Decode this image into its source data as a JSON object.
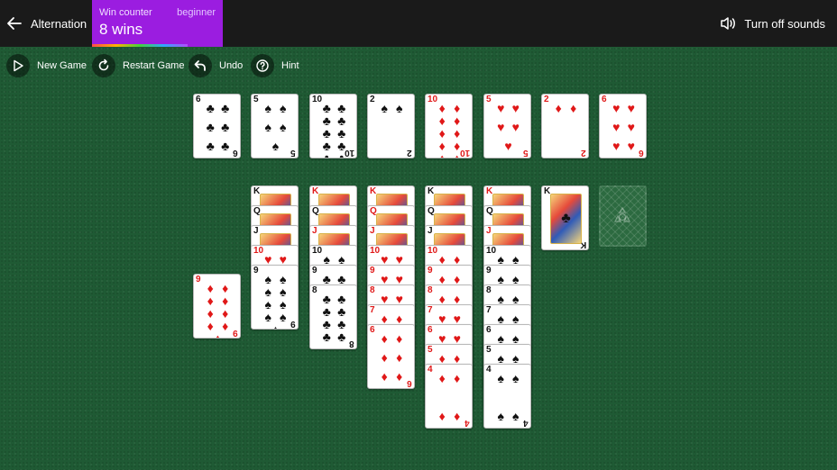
{
  "header": {
    "back_label": "Alternation",
    "win_counter_label": "Win counter",
    "level": "beginner",
    "wins": "8 wins",
    "sound_label": "Turn off sounds"
  },
  "toolbar": {
    "new_game": "New Game",
    "restart_game": "Restart Game",
    "undo": "Undo",
    "hint": "Hint"
  },
  "colors": {
    "felt": "#1f5a34",
    "topbar": "#1a1a1a",
    "win_card": "#9b1de0",
    "red_suit": "#e01818"
  },
  "foundations": [
    {
      "rank": "6",
      "suit": "♣",
      "color": "black"
    },
    {
      "rank": "5",
      "suit": "♠",
      "color": "black"
    },
    {
      "rank": "10",
      "suit": "♣",
      "color": "black"
    },
    {
      "rank": "2",
      "suit": "♠",
      "color": "black"
    },
    {
      "rank": "10",
      "suit": "♦",
      "color": "red"
    },
    {
      "rank": "5",
      "suit": "♥",
      "color": "red"
    },
    {
      "rank": "2",
      "suit": "♦",
      "color": "red"
    },
    {
      "rank": "6",
      "suit": "♥",
      "color": "red"
    }
  ],
  "tableau": [
    {
      "cards": [
        {
          "rank": "9",
          "suit": "♦",
          "color": "red"
        }
      ]
    },
    {
      "cards": [
        {
          "rank": "K",
          "suit": "♠",
          "color": "black"
        },
        {
          "rank": "Q",
          "suit": "♣",
          "color": "black"
        },
        {
          "rank": "J",
          "suit": "♣",
          "color": "black"
        },
        {
          "rank": "10",
          "suit": "♥",
          "color": "red"
        },
        {
          "rank": "9",
          "suit": "♠",
          "color": "black"
        }
      ]
    },
    {
      "cards": [
        {
          "rank": "K",
          "suit": "♦",
          "color": "red"
        },
        {
          "rank": "Q",
          "suit": "♠",
          "color": "black"
        },
        {
          "rank": "J",
          "suit": "♥",
          "color": "red"
        },
        {
          "rank": "10",
          "suit": "♠",
          "color": "black"
        },
        {
          "rank": "9",
          "suit": "♣",
          "color": "black"
        },
        {
          "rank": "8",
          "suit": "♣",
          "color": "black"
        }
      ]
    },
    {
      "cards": [
        {
          "rank": "K",
          "suit": "♥",
          "color": "red"
        },
        {
          "rank": "Q",
          "suit": "♥",
          "color": "red"
        },
        {
          "rank": "J",
          "suit": "♦",
          "color": "red"
        },
        {
          "rank": "10",
          "suit": "♥",
          "color": "red"
        },
        {
          "rank": "9",
          "suit": "♥",
          "color": "red"
        },
        {
          "rank": "8",
          "suit": "♥",
          "color": "red"
        },
        {
          "rank": "7",
          "suit": "♦",
          "color": "red"
        },
        {
          "rank": "6",
          "suit": "♦",
          "color": "red"
        }
      ]
    },
    {
      "cards": [
        {
          "rank": "K",
          "suit": "♣",
          "color": "black"
        },
        {
          "rank": "Q",
          "suit": "♣",
          "color": "black"
        },
        {
          "rank": "J",
          "suit": "♣",
          "color": "black"
        },
        {
          "rank": "10",
          "suit": "♦",
          "color": "red"
        },
        {
          "rank": "9",
          "suit": "♦",
          "color": "red"
        },
        {
          "rank": "8",
          "suit": "♦",
          "color": "red"
        },
        {
          "rank": "7",
          "suit": "♥",
          "color": "red"
        },
        {
          "rank": "6",
          "suit": "♥",
          "color": "red"
        },
        {
          "rank": "5",
          "suit": "♦",
          "color": "red"
        },
        {
          "rank": "4",
          "suit": "♦",
          "color": "red"
        }
      ]
    },
    {
      "cards": [
        {
          "rank": "K",
          "suit": "♦",
          "color": "red"
        },
        {
          "rank": "Q",
          "suit": "♠",
          "color": "black"
        },
        {
          "rank": "J",
          "suit": "♦",
          "color": "red"
        },
        {
          "rank": "10",
          "suit": "♠",
          "color": "black"
        },
        {
          "rank": "9",
          "suit": "♠",
          "color": "black"
        },
        {
          "rank": "8",
          "suit": "♠",
          "color": "black"
        },
        {
          "rank": "7",
          "suit": "♠",
          "color": "black"
        },
        {
          "rank": "6",
          "suit": "♠",
          "color": "black"
        },
        {
          "rank": "5",
          "suit": "♠",
          "color": "black"
        },
        {
          "rank": "4",
          "suit": "♠",
          "color": "black"
        }
      ]
    },
    {
      "cards": [
        {
          "rank": "K",
          "suit": "♣",
          "color": "black"
        }
      ]
    }
  ],
  "stock": {
    "state": "empty-recycle"
  }
}
